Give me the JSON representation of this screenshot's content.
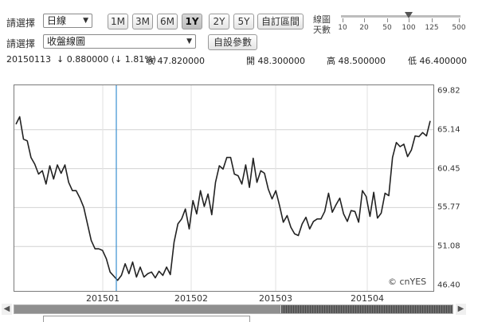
{
  "toolbar": {
    "select_label_1": "請選擇",
    "period_select": "日線",
    "range_buttons": [
      "1M",
      "3M",
      "6M",
      "1Y",
      "2Y",
      "5Y"
    ],
    "active_range": "1Y",
    "custom_range_button": "自訂區間",
    "select_label_2": "請選擇",
    "chart_style_select": "收盤線圖",
    "custom_params_button": "自設參數",
    "ma_days_label": "線圖\n天數",
    "slider_values": [
      "10",
      "20",
      "50",
      "100",
      "125",
      "500"
    ],
    "slider_selected": "100"
  },
  "quote": {
    "date": "20150113",
    "change": "↓ 0.880000 (↓ 1.81%)",
    "close": "收 47.820000",
    "open": "開 48.300000",
    "high": "高 48.500000",
    "low": "低 46.400000"
  },
  "chart_data": {
    "type": "line",
    "y_ticks": [
      "69.82",
      "65.14",
      "60.45",
      "55.77",
      "51.08",
      "46.40"
    ],
    "x_ticks": [
      "201501",
      "201502",
      "201503",
      "201504"
    ],
    "ylim": [
      46.4,
      69.82
    ],
    "credit": "© cnYES",
    "cursor_date": "20150113",
    "series": [
      {
        "values": [
          65.8,
          66.7,
          64.0,
          63.8,
          61.8,
          61.0,
          59.8,
          60.2,
          58.6,
          60.8,
          59.2,
          60.9,
          59.9,
          60.9,
          58.8,
          57.8,
          57.8,
          56.9,
          55.8,
          53.8,
          51.8,
          50.8,
          50.8,
          50.6,
          49.6,
          48.0,
          47.5,
          47.0,
          47.6,
          49.0,
          47.8,
          49.2,
          47.4,
          48.6,
          47.4,
          47.8,
          48.0,
          47.3,
          48.1,
          47.6,
          48.6,
          47.7,
          51.6,
          53.8,
          54.4,
          55.6,
          53.2,
          56.6,
          55.0,
          57.8,
          55.9,
          57.4,
          54.9,
          58.8,
          60.8,
          60.4,
          61.8,
          61.8,
          59.8,
          59.6,
          58.6,
          60.9,
          58.2,
          61.7,
          58.8,
          60.2,
          59.9,
          58.0,
          56.8,
          57.8,
          56.0,
          54.0,
          54.8,
          53.4,
          52.6,
          52.4,
          53.8,
          54.6,
          53.2,
          54.1,
          54.4,
          54.4,
          55.3,
          57.5,
          55.2,
          56.1,
          56.9,
          55.0,
          54.1,
          55.4,
          55.3,
          54.0,
          57.8,
          57.1,
          54.7,
          57.6,
          54.5,
          55.1,
          57.5,
          57.2,
          61.8,
          63.6,
          63.1,
          63.4,
          61.9,
          62.7,
          64.4,
          64.3,
          64.8,
          64.4,
          66.2
        ]
      }
    ]
  },
  "scrollbar": {
    "left_arrow": "◀",
    "right_arrow": "▶"
  }
}
